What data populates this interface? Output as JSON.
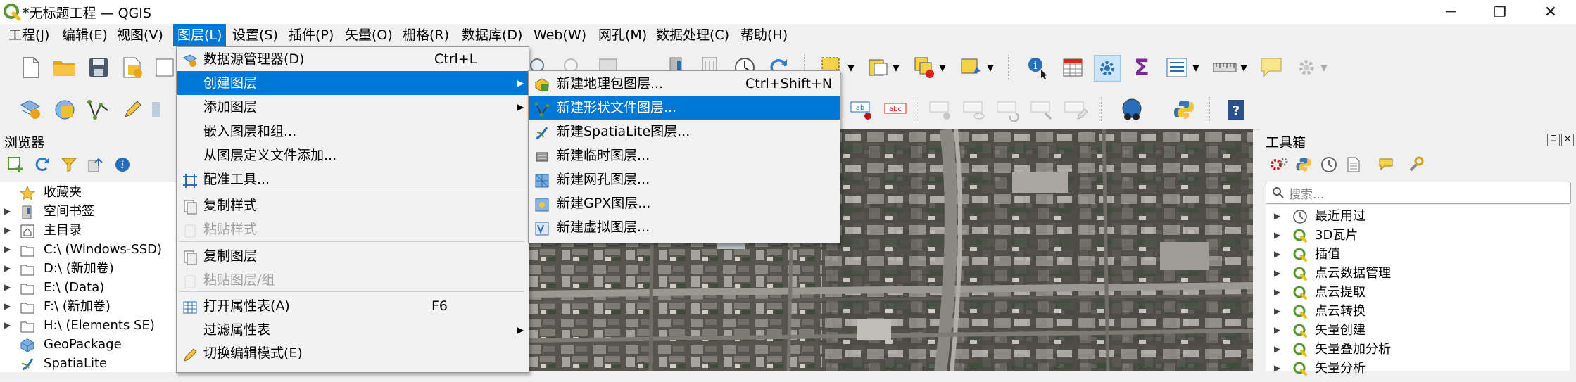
{
  "window": {
    "title": "*无标题工程 — QGIS",
    "minimize": "─",
    "maximize": "❐",
    "close": "✕"
  },
  "menubar": [
    {
      "label": "工程(J)"
    },
    {
      "label": "编辑(E)"
    },
    {
      "label": "视图(V)"
    },
    {
      "label": "图层(L)",
      "active": true
    },
    {
      "label": "设置(S)"
    },
    {
      "label": "插件(P)"
    },
    {
      "label": "矢量(O)"
    },
    {
      "label": "栅格(R)"
    },
    {
      "label": "数据库(D)"
    },
    {
      "label": "Web(W)"
    },
    {
      "label": "网孔(M)"
    },
    {
      "label": "数据处理(C)"
    },
    {
      "label": "帮助(H)"
    }
  ],
  "layer_menu": [
    {
      "label": "数据源管理器(D)",
      "shortcut": "Ctrl+L",
      "icon": "data-source-icon"
    },
    {
      "label": "创建图层",
      "submenu": true,
      "selected": true
    },
    {
      "label": "添加图层",
      "submenu": true
    },
    {
      "label": "嵌入图层和组..."
    },
    {
      "label": "从图层定义文件添加..."
    },
    {
      "label": "配准工具...",
      "icon": "georeferencer-icon"
    },
    {
      "label": "复制样式",
      "icon": "copy-style-icon"
    },
    {
      "label": "粘贴样式",
      "disabled": true,
      "icon": "paste-style-icon"
    },
    {
      "label": "复制图层",
      "icon": "copy-layer-icon"
    },
    {
      "label": "粘贴图层/组",
      "disabled": true,
      "icon": "paste-layer-icon"
    },
    {
      "label": "打开属性表(A)",
      "shortcut": "F6",
      "icon": "attribute-table-icon"
    },
    {
      "label": "过滤属性表",
      "submenu": true
    },
    {
      "label": "切换编辑模式(E)",
      "icon": "pencil-icon"
    }
  ],
  "create_layer_submenu": [
    {
      "label": "新建地理包图层...",
      "shortcut": "Ctrl+Shift+N",
      "icon": "geopackage-layer-icon"
    },
    {
      "label": "新建形状文件图层...",
      "selected": true,
      "icon": "shapefile-layer-icon"
    },
    {
      "label": "新建SpatiaLite图层...",
      "icon": "spatialite-layer-icon"
    },
    {
      "label": "新建临时图层...",
      "icon": "temporary-layer-icon"
    },
    {
      "label": "新建网孔图层...",
      "icon": "mesh-layer-icon"
    },
    {
      "label": "新建GPX图层...",
      "icon": "gpx-layer-icon"
    },
    {
      "label": "新建虚拟图层...",
      "icon": "virtual-layer-icon"
    }
  ],
  "browser": {
    "title": "浏览器",
    "items": [
      {
        "label": "收藏夹",
        "icon": "star-icon",
        "expander": false
      },
      {
        "label": "空间书签",
        "icon": "bookmark-icon",
        "expander": true
      },
      {
        "label": "主目录",
        "icon": "home-icon",
        "expander": true
      },
      {
        "label": "C:\\ (Windows-SSD)",
        "icon": "folder-icon",
        "expander": true
      },
      {
        "label": "D:\\ (新加卷)",
        "icon": "folder-icon",
        "expander": true
      },
      {
        "label": "E:\\ (Data)",
        "icon": "folder-icon",
        "expander": true
      },
      {
        "label": "F:\\ (新加卷)",
        "icon": "folder-icon",
        "expander": true
      },
      {
        "label": "H:\\ (Elements SE)",
        "icon": "folder-icon",
        "expander": true
      },
      {
        "label": "GeoPackage",
        "icon": "geopackage-icon",
        "expander": false
      },
      {
        "label": "SpatiaLite",
        "icon": "spatialite-icon",
        "expander": false
      }
    ]
  },
  "toolbox": {
    "title": "工具箱",
    "search_placeholder": "搜索...",
    "items": [
      {
        "label": "最近用过",
        "icon": "clock-icon"
      },
      {
        "label": "3D瓦片",
        "icon": "qgis-icon"
      },
      {
        "label": "插值",
        "icon": "qgis-icon"
      },
      {
        "label": "点云数据管理",
        "icon": "qgis-icon"
      },
      {
        "label": "点云提取",
        "icon": "qgis-icon"
      },
      {
        "label": "点云转换",
        "icon": "qgis-icon"
      },
      {
        "label": "矢量创建",
        "icon": "qgis-icon"
      },
      {
        "label": "矢量叠加分析",
        "icon": "qgis-icon"
      },
      {
        "label": "矢量分析",
        "icon": "qgis-icon"
      }
    ]
  },
  "colors": {
    "accent": "#0078d7",
    "qgis_green": "#589632",
    "qgis_yellow": "#eec200"
  }
}
